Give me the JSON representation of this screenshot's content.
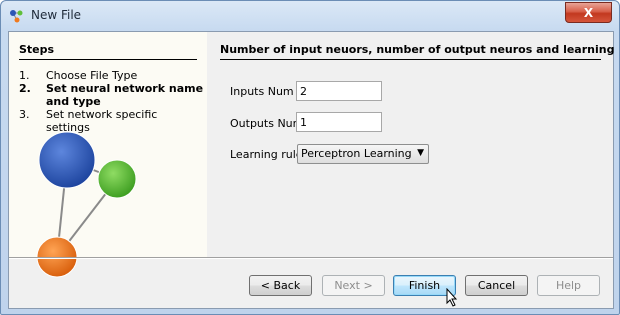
{
  "window": {
    "title": "New File",
    "close_label": "X",
    "icon": "app-molecule-icon"
  },
  "steps": {
    "title": "Steps",
    "items": [
      {
        "num": "1.",
        "label": "Choose File Type",
        "current": false
      },
      {
        "num": "2.",
        "label": "Set neural network name and type",
        "current": true
      },
      {
        "num": "3.",
        "label": "Set network specific settings",
        "current": false
      }
    ]
  },
  "panel": {
    "title": "Number of input neuors, number of output neuros and learning rule",
    "inputs_label": "Inputs Num",
    "inputs_value": "2",
    "outputs_label": "Outputs Num",
    "outputs_value": "1",
    "rule_label": "Learning rule",
    "rule_value": "Perceptron Learning"
  },
  "buttons": {
    "back": "< Back",
    "next": "Next >",
    "finish": "Finish",
    "cancel": "Cancel",
    "help": "Help"
  },
  "colors": {
    "node_blue": "#2b56b5",
    "node_green": "#5fbf3a",
    "node_orange": "#f07a1e"
  }
}
